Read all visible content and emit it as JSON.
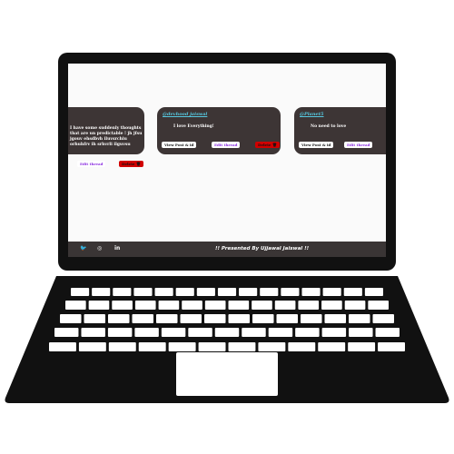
{
  "cards": [
    {
      "handle": "",
      "text_lines": [
        "I have some suddenly thoughts",
        "that are un predictable ! jh jfsu",
        "jgouv ehsdbvh iluvsrchiu",
        "orhuhfrv ih srhvrli ilguvsu"
      ],
      "edit_label": "Edit thread",
      "delete_label": "Delete 🗑",
      "view_label": ""
    },
    {
      "handle": "@devhood jaiswal",
      "text_lines": [
        "I love Everything!"
      ],
      "view_label": "View Post & id",
      "edit_label": "Edit thread",
      "delete_label": "Delete 🗑"
    },
    {
      "handle": "@Planet5",
      "text_lines": [
        "No need to love"
      ],
      "view_label": "View Post & id",
      "edit_label": "Edit thread",
      "delete_label": ""
    }
  ],
  "footer": {
    "icons": [
      "twitter-icon",
      "instagram-icon",
      "linkedin-icon"
    ],
    "twitter": "🐦",
    "instagram": "◎",
    "linkedin": "in",
    "credit": "!! Presented By Ujjawal Jaiswal !!"
  },
  "colors": {
    "card_bg": "#3d3535",
    "handle": "#56c8e0",
    "edit_text": "#8a2ce0",
    "delete_bg": "#d10000",
    "footer_bg": "#3a3535"
  }
}
